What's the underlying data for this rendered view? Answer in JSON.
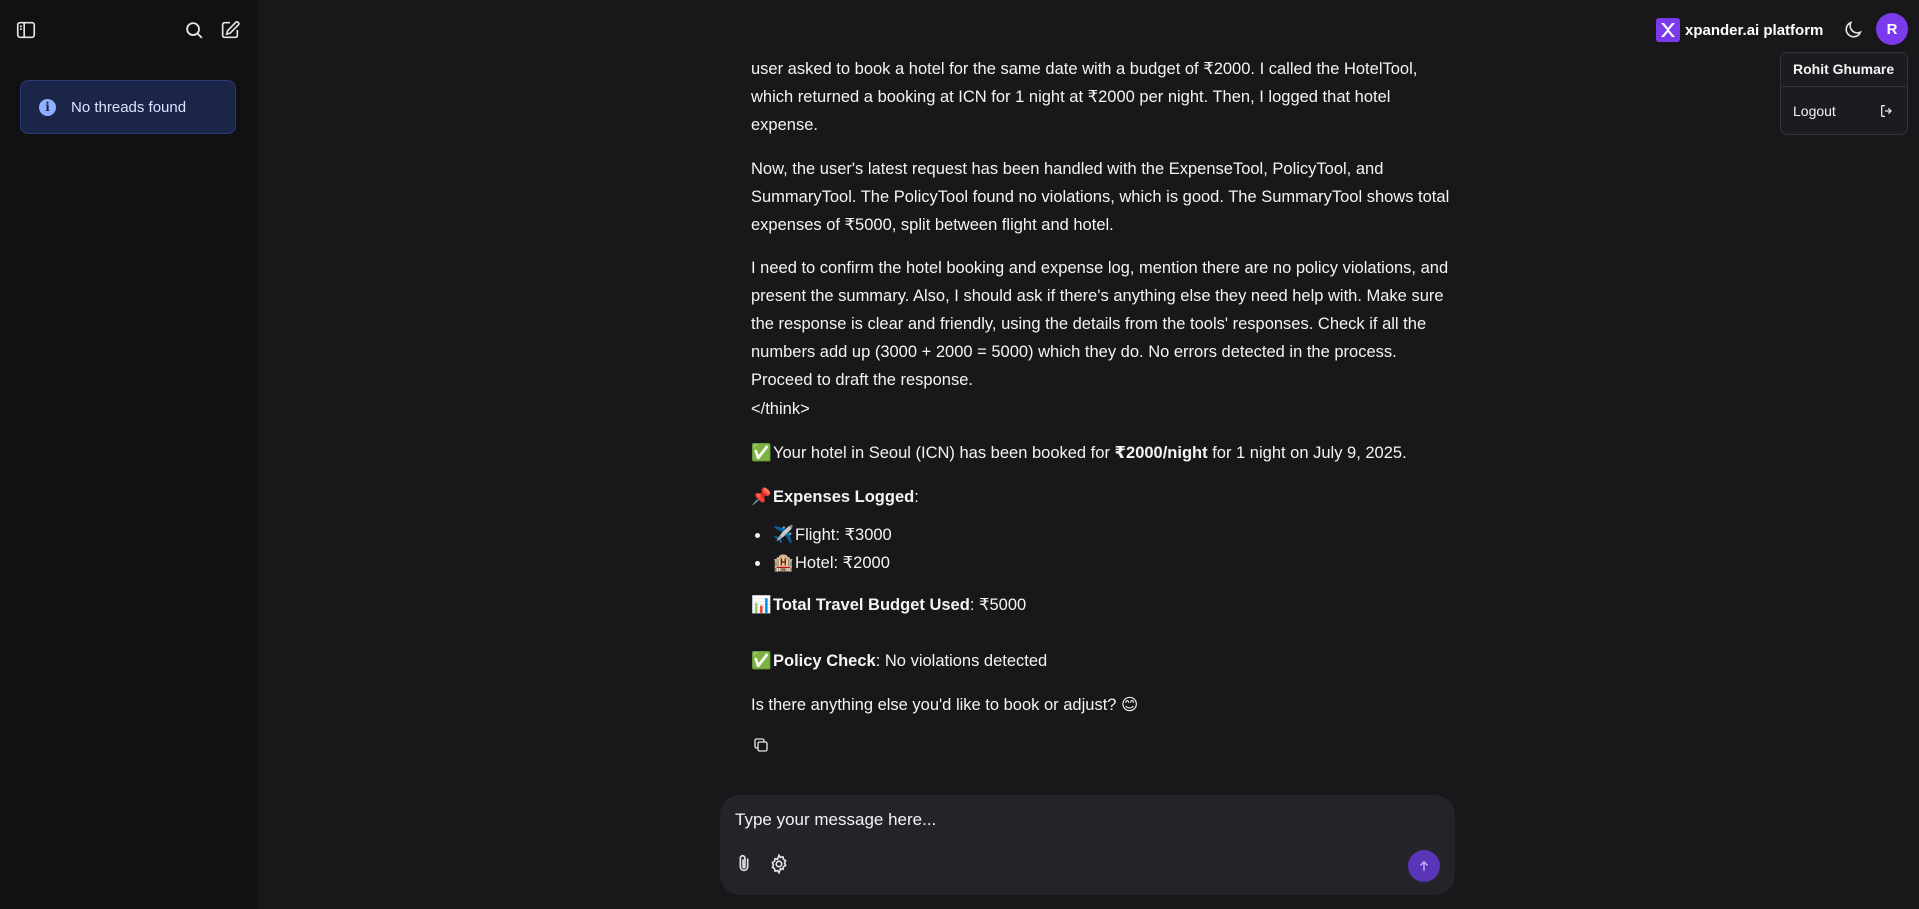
{
  "colors": {
    "background": "#18181b",
    "sidebar": "#111114",
    "accent": "#7c3aed",
    "notice_bg": "#1b2547"
  },
  "sidebar": {
    "toggle_icon": "sidebar-toggle-icon",
    "search_icon": "search-icon",
    "new_thread_icon": "new-thread-icon",
    "notice": "No threads found"
  },
  "header": {
    "brand": "xpander.ai platform",
    "avatar_initial": "R",
    "user_menu": {
      "name": "Rohit Ghumare",
      "logout": "Logout"
    }
  },
  "message": {
    "think_para1": "user asked to book a hotel for the same date with a budget of ₹2000. I called the HotelTool, which returned a booking at ICN for 1 night at ₹2000 per night. Then, I logged that hotel expense.",
    "think_para2": "Now, the user's latest request has been handled with the ExpenseTool, PolicyTool, and SummaryTool. The PolicyTool found no violations, which is good. The SummaryTool shows total expenses of ₹5000, split between flight and hotel.",
    "think_para3": "I need to confirm the hotel booking and expense log, mention there are no policy violations, and present the summary. Also, I should ask if there's anything else they need help with. Make sure the response is clear and friendly, using the details from the tools' responses. Check if all the numbers add up (3000 + 2000 = 5000) which they do. No errors detected in the process. Proceed to draft the response.",
    "think_close": "</think>",
    "booking_pre": "Your hotel in Seoul (ICN) has been booked for ",
    "booking_bold": "₹2000/night",
    "booking_post": " for 1 night on July 9, 2025.",
    "expenses_label": "Expenses Logged",
    "expenses": [
      {
        "emoji": "✈️",
        "text": "Flight: ₹3000"
      },
      {
        "emoji": "🏨",
        "text": "Hotel: ₹2000"
      }
    ],
    "total_label": "Total Travel Budget Used",
    "total_value": ": ₹5000",
    "policy_label": "Policy Check",
    "policy_value": ": No violations detected",
    "closing": "Is there anything else you'd like to book or adjust? 😊",
    "emoji_check": "✅",
    "emoji_pin": "📌",
    "emoji_chart": "📊"
  },
  "composer": {
    "placeholder": "Type your message here...",
    "attach_icon": "paperclip-icon",
    "settings_icon": "gear-icon",
    "send_icon": "arrow-up-icon"
  }
}
